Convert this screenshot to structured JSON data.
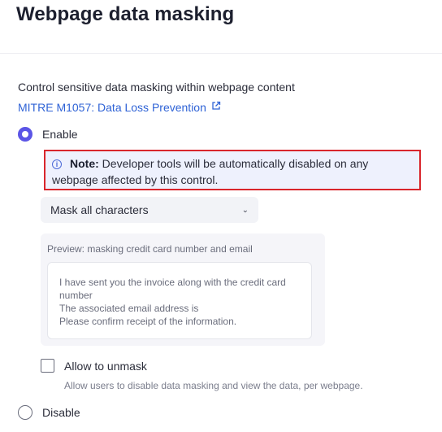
{
  "page": {
    "title": "Webpage data masking"
  },
  "description": "Control sensitive data masking within webpage content",
  "mitre_link": {
    "label": "MITRE M1057: Data Loss Prevention",
    "icon": "external-link-icon"
  },
  "options": {
    "enable": {
      "label": "Enable",
      "selected": true
    },
    "disable": {
      "label": "Disable",
      "selected": false
    }
  },
  "note": {
    "icon": "info-icon",
    "label": "Note:",
    "text": " Developer tools will be automatically disabled on any webpage affected by this control."
  },
  "masking_select": {
    "value": "Mask all characters"
  },
  "preview": {
    "label": "Preview: masking credit card number and email",
    "lines": [
      "I have sent you the invoice along with the credit card number",
      "The associated email address is",
      "Please confirm receipt of the information."
    ]
  },
  "unmask": {
    "label": "Allow to unmask",
    "checked": false,
    "helper": "Allow users to disable data masking and view the data, per webpage."
  },
  "colors": {
    "accent": "#5b55e6",
    "link": "#2f63d6",
    "highlight_border": "#d9262c",
    "note_bg": "#eef1fd"
  }
}
